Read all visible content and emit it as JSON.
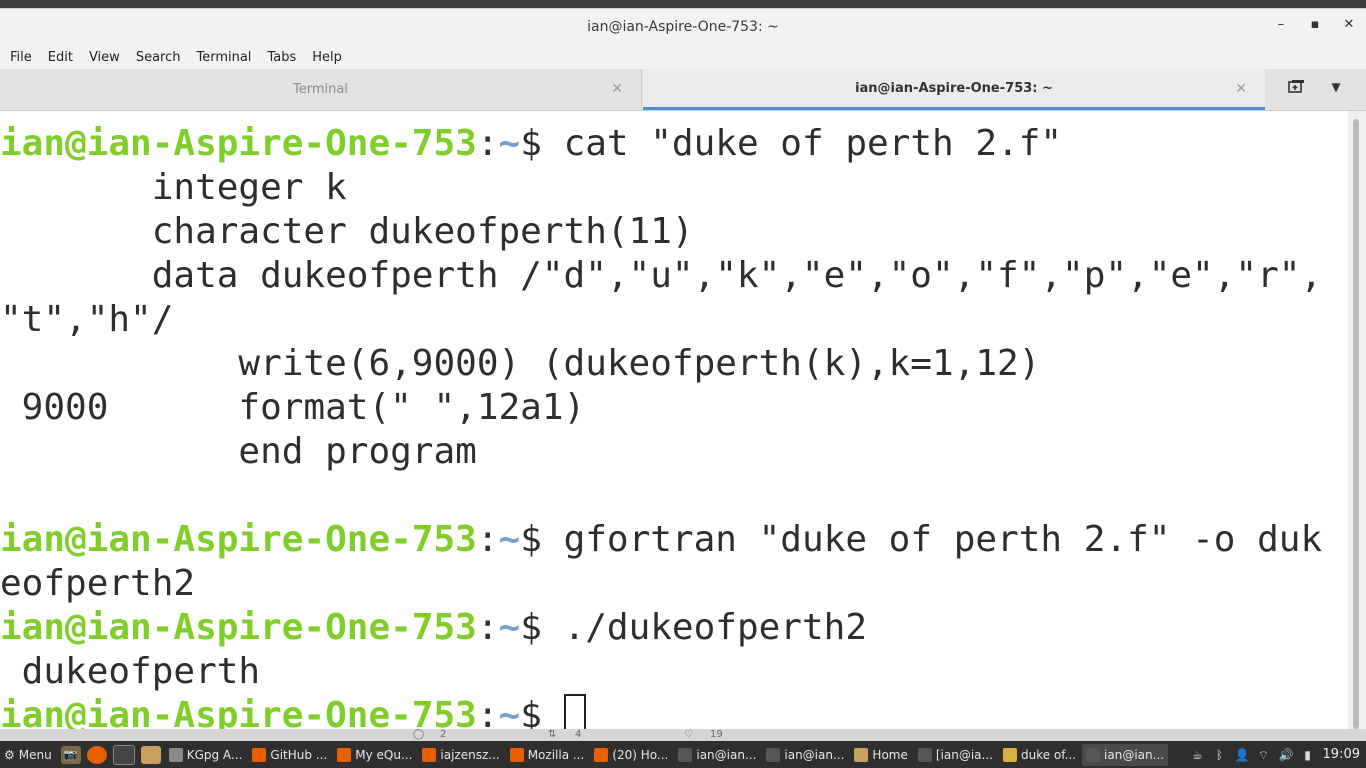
{
  "window": {
    "title": "ian@ian-Aspire-One-753: ~",
    "controls": {
      "minimize": "–",
      "maximize": "▪",
      "close": "✕"
    }
  },
  "menu": [
    "File",
    "Edit",
    "View",
    "Search",
    "Terminal",
    "Tabs",
    "Help"
  ],
  "tabs": [
    {
      "label": "Terminal",
      "close": "✕"
    },
    {
      "label": "ian@ian-Aspire-One-753: ~",
      "close": "✕"
    }
  ],
  "terminal": {
    "prompt_user": "ian@ian-Aspire-One-753",
    "prompt_path": "~",
    "lines": [
      {
        "kind": "prompt",
        "cmd": "cat \"duke of perth 2.f\""
      },
      {
        "kind": "out",
        "text": "       integer k"
      },
      {
        "kind": "out",
        "text": "       character dukeofperth(11)"
      },
      {
        "kind": "out",
        "text": "       data dukeofperth /\"d\",\"u\",\"k\",\"e\",\"o\",\"f\",\"p\",\"e\",\"r\","
      },
      {
        "kind": "out",
        "text": "\"t\",\"h\"/"
      },
      {
        "kind": "out",
        "text": "           write(6,9000) (dukeofperth(k),k=1,12)"
      },
      {
        "kind": "out",
        "text": " 9000      format(\" \",12a1)"
      },
      {
        "kind": "out",
        "text": "           end program"
      },
      {
        "kind": "out",
        "text": ""
      },
      {
        "kind": "prompt",
        "cmd": "gfortran \"duke of perth 2.f\" -o duk"
      },
      {
        "kind": "out",
        "text": "eofperth2"
      },
      {
        "kind": "prompt",
        "cmd": "./dukeofperth2"
      },
      {
        "kind": "out",
        "text": " dukeofperth"
      },
      {
        "kind": "prompt",
        "cmd": "",
        "cursor": true
      }
    ]
  },
  "behind_window": {
    "counts": [
      "2",
      "4",
      "19"
    ]
  },
  "taskbar": {
    "menu_label": "Menu",
    "tasks": [
      {
        "label": "KGpg A...",
        "color": "#8a8a8a"
      },
      {
        "label": "GitHub ...",
        "color": "#e66000"
      },
      {
        "label": "My eQu...",
        "color": "#e66000"
      },
      {
        "label": "iajzensz...",
        "color": "#e66000"
      },
      {
        "label": "Mozilla ...",
        "color": "#e66000"
      },
      {
        "label": "(20) Ho...",
        "color": "#e66000"
      },
      {
        "label": "ian@ian...",
        "color": "#555555"
      },
      {
        "label": "ian@ian...",
        "color": "#555555"
      },
      {
        "label": "Home",
        "color": "#c8a060"
      },
      {
        "label": "[ian@ia...",
        "color": "#555555"
      },
      {
        "label": "duke of...",
        "color": "#d8b040"
      },
      {
        "label": "ian@ian...",
        "color": "#555555"
      }
    ],
    "clock": "19:09"
  },
  "colors": {
    "prompt_user": "#7fce2a",
    "prompt_path": "#729fcf",
    "active_tab_indicator": "#4a90d9"
  }
}
